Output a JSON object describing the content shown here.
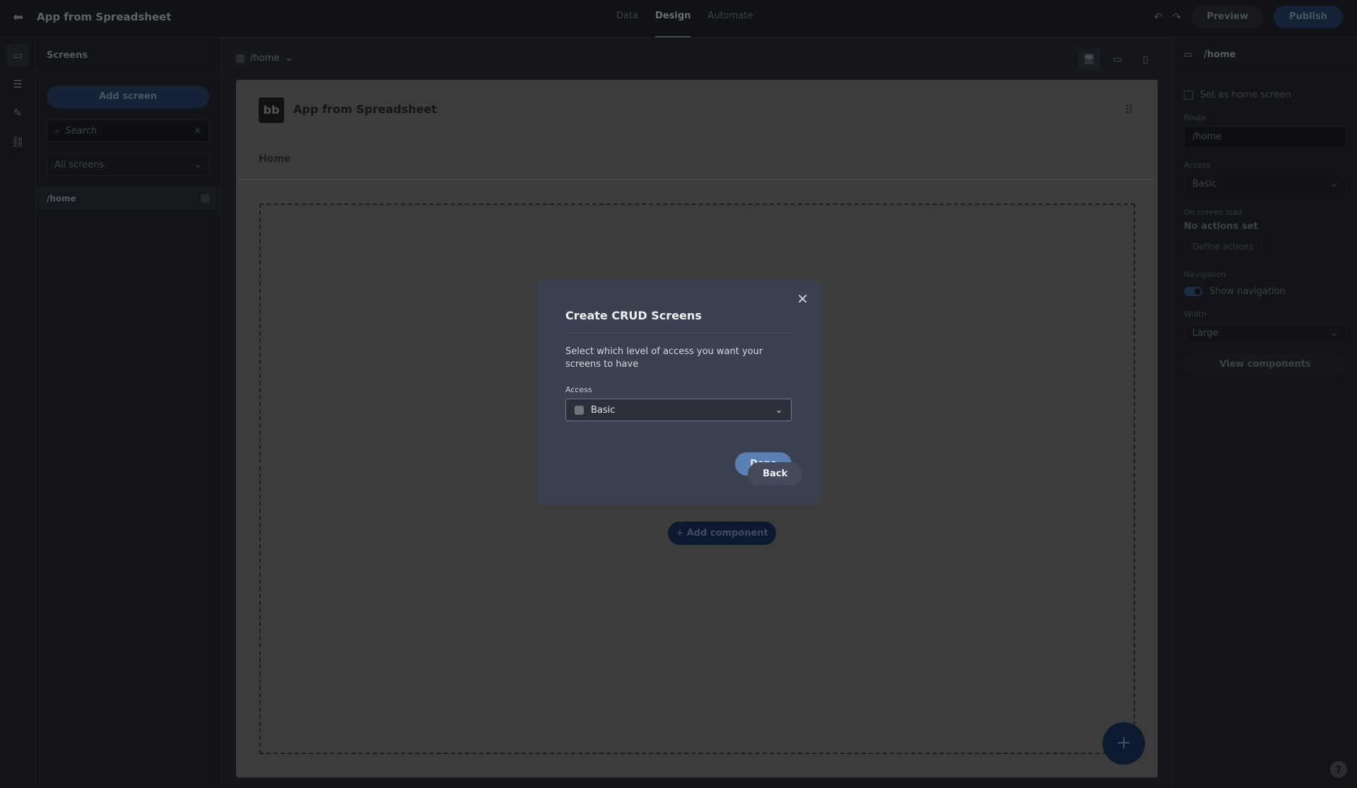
{
  "topbar": {
    "title": "App from Spreadsheet",
    "tabs": [
      "Data",
      "Design",
      "Automate"
    ],
    "active_tab": "Design",
    "preview": "Preview",
    "publish": "Publish"
  },
  "screens_panel": {
    "title": "Screens",
    "add_screen": "Add screen",
    "search_placeholder": "Search",
    "filter": "All screens",
    "items": [
      {
        "label": "/home"
      }
    ]
  },
  "canvas": {
    "breadcrumb": "/home",
    "app_title": "App from Spreadsheet",
    "logo": "bb",
    "nav_item": "Home",
    "add_component": "Add component"
  },
  "settings": {
    "title": "/home",
    "set_home": "Set as home screen",
    "route_label": "Route",
    "route_value": "/home",
    "access_label": "Access",
    "access_value": "Basic",
    "onload_label": "On screen load",
    "onload_value": "No actions set",
    "define_actions": "Define actions",
    "navigation_label": "Navigation",
    "show_navigation": "Show navigation",
    "show_navigation_on": true,
    "width_label": "Width",
    "width_value": "Large",
    "view_components": "View components"
  },
  "modal": {
    "title": "Create CRUD Screens",
    "description": "Select which level of access you want your screens to have",
    "access_label": "Access",
    "access_value": "Basic",
    "back": "Back",
    "done": "Done"
  },
  "colors": {
    "accent": "#5a80b4",
    "modal_bg": "#3b4151"
  }
}
